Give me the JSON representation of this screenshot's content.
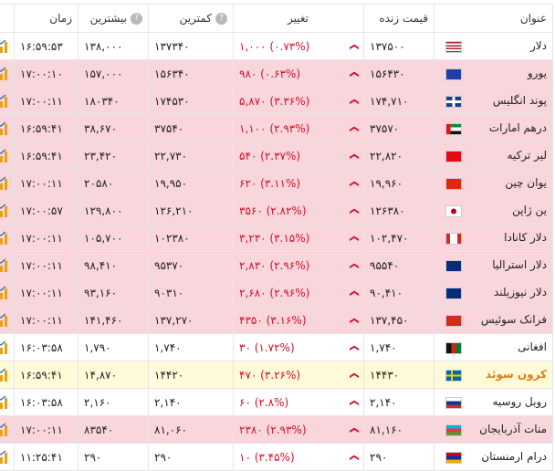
{
  "header": {
    "name": "عنوان",
    "price": "قیمت زنده",
    "change": "تغییر",
    "low": "کمترین",
    "high": "بیشترین",
    "time": "زمان",
    "help": "?"
  },
  "rows": [
    {
      "name": "دلار",
      "price": "۱۳۷۵۰۰",
      "change": "۱,۰۰۰ (۰.۷۳%)",
      "low": "۱۳۷۳۴۰",
      "high": "۱۳۸,۰۰۰",
      "time": "۱۶:۵۹:۵۳",
      "status": "green",
      "flag": "us"
    },
    {
      "name": "یورو",
      "price": "۱۵۶۴۳۰",
      "change": "۹۸۰ (۰.۶۳%)",
      "low": "۱۵۶۳۴۰",
      "high": "۱۵۷,۰۰۰",
      "time": "۱۷:۰۰:۱۰",
      "status": "red",
      "flag": "eu"
    },
    {
      "name": "پوند انگلیس",
      "price": "۱۷۴,۷۱۰",
      "change": "۵,۸۷۰ (۳.۳۶%)",
      "low": "۱۷۴۵۳۰",
      "high": "۱۸۰۳۴۰",
      "time": "۱۷:۰۰:۱۱",
      "status": "red",
      "flag": "gb"
    },
    {
      "name": "درهم امارات",
      "price": "۳۷۵۷۰",
      "change": "۱,۱۰۰ (۲.۹۳%)",
      "low": "۳۷۵۴۰",
      "high": "۳۸,۶۷۰",
      "time": "۱۶:۵۹:۴۱",
      "status": "red",
      "flag": "ae"
    },
    {
      "name": "لیر ترکیه",
      "price": "۲۲,۸۲۰",
      "change": "۵۴۰ (۲.۳۷%)",
      "low": "۲۲,۷۳۰",
      "high": "۲۳,۴۲۰",
      "time": "۱۶:۵۹:۴۱",
      "status": "red",
      "flag": "tr"
    },
    {
      "name": "یوان چین",
      "price": "۱۹,۹۶۰",
      "change": "۶۲۰ (۳.۱۱%)",
      "low": "۱۹,۹۵۰",
      "high": "۲۰۵۸۰",
      "time": "۱۷:۰۰:۱۱",
      "status": "red",
      "flag": "cn"
    },
    {
      "name": "ین ژاپن",
      "price": "۱۲۶۳۸۰",
      "change": "۳۵۶۰ (۲.۸۲%)",
      "low": "۱۲۶,۲۱۰",
      "high": "۱۲۹,۸۰۰",
      "time": "۱۷:۰۰:۵۷",
      "status": "red",
      "flag": "jp"
    },
    {
      "name": "دلار کانادا",
      "price": "۱۰۲,۴۷۰",
      "change": "۳,۲۳۰ (۳.۱۵%)",
      "low": "۱۰۲۳۸۰",
      "high": "۱۰۵,۷۰۰",
      "time": "۱۷:۰۰:۱۱",
      "status": "red",
      "flag": "ca"
    },
    {
      "name": "دلار استرالیا",
      "price": "۹۵۵۴۰",
      "change": "۲,۸۳۰ (۲.۹۶%)",
      "low": "۹۵۳۷۰",
      "high": "۹۸,۴۱۰",
      "time": "۱۷:۰۰:۱۱",
      "status": "red",
      "flag": "au"
    },
    {
      "name": "دلار نیوزیلند",
      "price": "۹۰,۴۱۰",
      "change": "۲,۶۸۰ (۲.۹۶%)",
      "low": "۹۰۳۱۰",
      "high": "۹۳,۱۶۰",
      "time": "۱۷:۰۰:۱۱",
      "status": "red",
      "flag": "nz"
    },
    {
      "name": "فرانک سوئیس",
      "price": "۱۳۷,۴۵۰",
      "change": "۴۳۵۰ (۳.۱۶%)",
      "low": "۱۳۷,۲۷۰",
      "high": "۱۴۱,۴۶۰",
      "time": "۱۷:۰۰:۱۱",
      "status": "red",
      "flag": "ch"
    },
    {
      "name": "افغانی",
      "price": "۱,۷۴۰",
      "change": "۳۰ (۱.۷۲%)",
      "low": "۱,۷۴۰",
      "high": "۱,۷۹۰",
      "time": "۱۶:۰۳:۵۸",
      "status": "green",
      "flag": "af"
    },
    {
      "name": "کرون سوئد",
      "price": "۱۴۴۳۰",
      "change": "۴۷۰ (۳.۲۶%)",
      "low": "۱۴۴۲۰",
      "high": "۱۴,۸۷۰",
      "time": "۱۶:۵۹:۴۱",
      "status": "highlight",
      "flag": "se"
    },
    {
      "name": "روبل روسیه",
      "price": "۲,۱۴۰",
      "change": "۶۰ (۲.۸%)",
      "low": "۲,۱۴۰",
      "high": "۲,۱۶۰",
      "time": "۱۶:۰۳:۵۸",
      "status": "green",
      "flag": "ru"
    },
    {
      "name": "منات آذربایجان",
      "price": "۸۱,۱۶۰",
      "change": "۲۳۸۰ (۲.۹۳%)",
      "low": "۸۱,۰۶۰",
      "high": "۸۳۵۴۰",
      "time": "۱۷:۰۰:۱۱",
      "status": "red",
      "flag": "az"
    },
    {
      "name": "درام ارمنستان",
      "price": "۲۹۰",
      "change": "۱۰ (۳.۴۵%)",
      "low": "۲۹۰",
      "high": "۲۹۰",
      "time": "۱۱:۲۵:۴۱",
      "status": "green",
      "flag": "am"
    }
  ],
  "colors": {
    "row_red": "#f9d6db",
    "row_highlight": "#fffbd9",
    "change_red": "#d0112b",
    "highlight_text": "#e07b12",
    "chart_icon": "#e8a21a"
  },
  "icons": {
    "change_direction": "chevron-down-icon",
    "chart": "chart-icon",
    "help": "help-icon"
  }
}
